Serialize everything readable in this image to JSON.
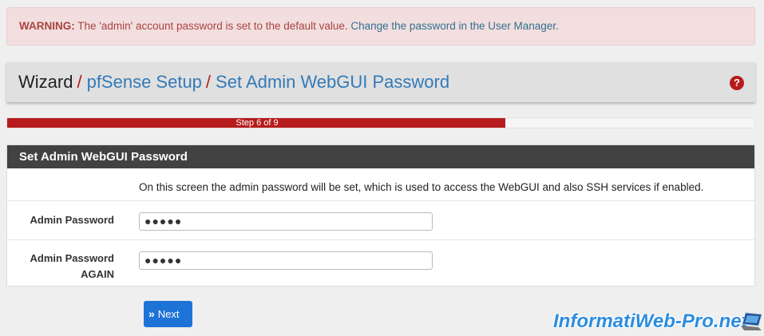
{
  "alert": {
    "title": "WARNING:",
    "message": "The 'admin' account password is set to the default value.",
    "link": "Change the password in the User Manager."
  },
  "breadcrumb": {
    "items": [
      "Wizard",
      "pfSense Setup",
      "Set Admin WebGUI Password"
    ],
    "separator": "/"
  },
  "progress": {
    "label": "Step 6 of 9",
    "current": 6,
    "total": 9
  },
  "panel": {
    "title": "Set Admin WebGUI Password",
    "description": "On this screen the admin password will be set, which is used to access the WebGUI and also SSH services if enabled.",
    "fields": [
      {
        "label": "Admin Password",
        "value": "●●●●●"
      },
      {
        "label_line1": "Admin Password",
        "label_line2": "AGAIN",
        "value": "●●●●●"
      }
    ]
  },
  "buttons": {
    "next": "Next"
  },
  "watermark": "InformatiWeb-Pro.net",
  "colors": {
    "brand": "#b71c1c",
    "link": "#337ab7",
    "button": "#1e73d6",
    "panel_header": "#424242"
  }
}
